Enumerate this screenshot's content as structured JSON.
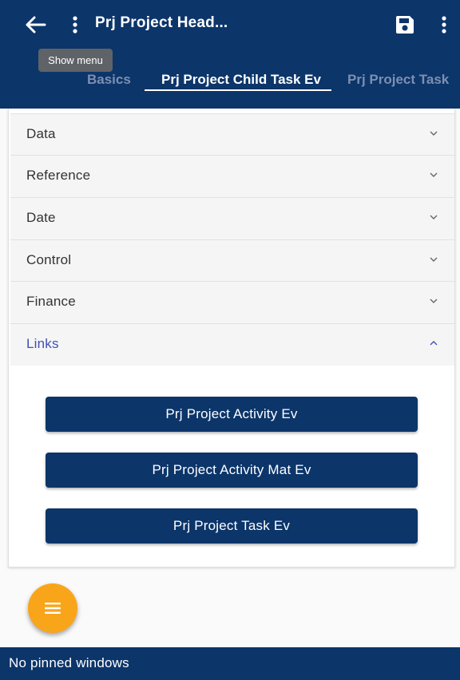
{
  "header": {
    "title": "Prj Project Head...",
    "tooltip": "Show menu",
    "icons": [
      "back-arrow-icon",
      "vertical-dots-icon",
      "save-icon",
      "vertical-dots-icon"
    ],
    "bar_color": "#0c356a"
  },
  "tabs": [
    {
      "label": "Basics",
      "active": false
    },
    {
      "label": "Prj Project Child Task Ev",
      "active": true
    },
    {
      "label": "Prj Project Task",
      "active": false
    }
  ],
  "sections": [
    {
      "label": "Data",
      "expanded": false
    },
    {
      "label": "Reference",
      "expanded": false
    },
    {
      "label": "Date",
      "expanded": false
    },
    {
      "label": "Control",
      "expanded": false
    },
    {
      "label": "Finance",
      "expanded": false
    },
    {
      "label": "Links",
      "expanded": true
    }
  ],
  "links": [
    {
      "label": "Prj Project Activity Ev"
    },
    {
      "label": "Prj Project Activity Mat Ev"
    },
    {
      "label": "Prj Project Task Ev"
    }
  ],
  "fab": {
    "icon": "hamburger-menu-icon",
    "color": "#f9a51a"
  },
  "footer": {
    "text": "No pinned windows"
  },
  "colors": {
    "accent": "#3f51b5",
    "primary": "#0c356a"
  }
}
